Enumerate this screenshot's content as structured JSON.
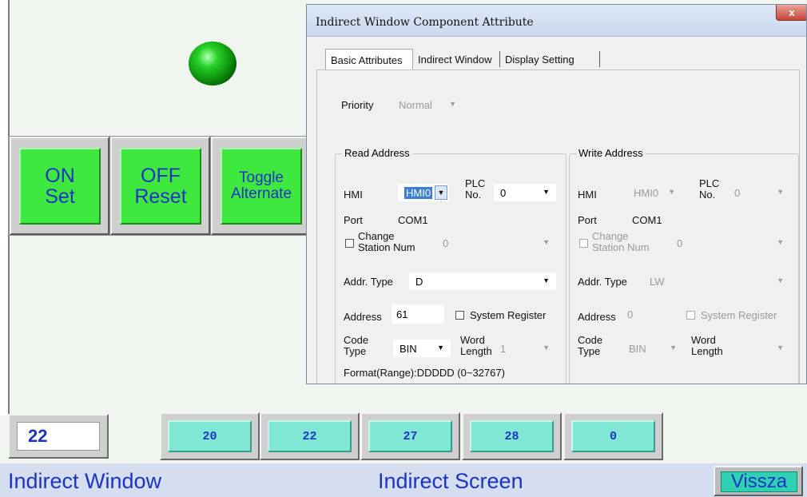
{
  "hmi": {
    "buttons": [
      {
        "line1": "ON",
        "line2": "Set"
      },
      {
        "line1": "OFF",
        "line2": "Reset"
      },
      {
        "line1": "Toggle",
        "line2": "Alternate"
      }
    ],
    "numeric_display": "22",
    "value_buttons": [
      "20",
      "22",
      "27",
      "28",
      "0"
    ],
    "footer_left": "Indirect Window",
    "footer_center": "Indirect Screen",
    "back_button": "Vissza"
  },
  "dialog": {
    "title": "Indirect Window Component Attribute",
    "close_glyph": "x",
    "tabs": [
      "Basic Attributes",
      "Indirect Window",
      "Display Setting"
    ],
    "priority_label": "Priority",
    "priority_value": "Normal",
    "read": {
      "group_title": "Read Address",
      "hmi_label": "HMI",
      "hmi_value": "HMI0",
      "plc_label_1": "PLC",
      "plc_label_2": "No.",
      "plc_value": "0",
      "port_label": "Port",
      "port_value": "COM1",
      "change_station_1": "Change",
      "change_station_2": "Station Num",
      "station_value": "0",
      "addr_type_label": "Addr. Type",
      "addr_type_value": "D",
      "address_label": "Address",
      "address_value": "61",
      "system_register_label": "System Register",
      "code_type_1": "Code",
      "code_type_2": "Type",
      "code_type_value": "BIN",
      "word_length_1": "Word",
      "word_length_2": "Length",
      "word_length_value": "1",
      "format_text": "Format(Range):DDDDD (0~32767)"
    },
    "write": {
      "group_title": "Write Address",
      "hmi_label": "HMI",
      "hmi_value": "HMI0",
      "plc_label_1": "PLC",
      "plc_label_2": "No.",
      "plc_value": "0",
      "port_label": "Port",
      "port_value": "COM1",
      "change_station_1": "Change",
      "change_station_2": "Station Num",
      "station_value": "0",
      "addr_type_label": "Addr. Type",
      "addr_type_value": "LW",
      "address_label": "Address",
      "address_value": "0",
      "system_register_label": "System Register",
      "code_type_1": "Code",
      "code_type_2": "Type",
      "code_type_value": "BIN",
      "word_length_1": "Word",
      "word_length_2": "Length",
      "word_length_value": ""
    }
  }
}
